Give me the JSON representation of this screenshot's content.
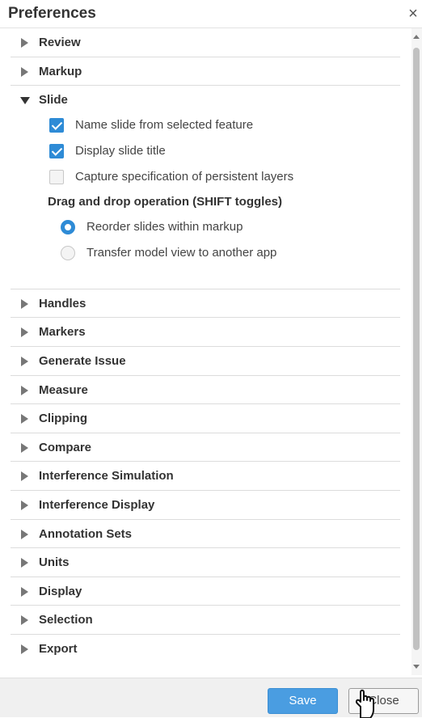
{
  "dialog": {
    "title": "Preferences",
    "close_glyph": "×"
  },
  "sections_top": [
    {
      "label": "Review",
      "expanded": false
    },
    {
      "label": "Markup",
      "expanded": false
    }
  ],
  "slide_section": {
    "label": "Slide",
    "expanded": true,
    "options": [
      {
        "label": "Name slide from selected feature",
        "checked": true
      },
      {
        "label": "Display slide title",
        "checked": true
      },
      {
        "label": "Capture specification of persistent layers",
        "checked": false
      }
    ],
    "drag_drop": {
      "title": "Drag and drop operation (SHIFT toggles)",
      "choices": [
        {
          "label": "Reorder slides within markup",
          "selected": true
        },
        {
          "label": "Transfer model view to another app",
          "selected": false
        }
      ]
    }
  },
  "sections_bottom": [
    {
      "label": "Handles"
    },
    {
      "label": "Markers"
    },
    {
      "label": "Generate Issue"
    },
    {
      "label": "Measure"
    },
    {
      "label": "Clipping"
    },
    {
      "label": "Compare"
    },
    {
      "label": "Interference Simulation"
    },
    {
      "label": "Interference Display"
    },
    {
      "label": "Annotation Sets"
    },
    {
      "label": "Units"
    },
    {
      "label": "Display"
    },
    {
      "label": "Selection"
    },
    {
      "label": "Export"
    }
  ],
  "footer": {
    "save_label": "Save",
    "close_label": "Close"
  },
  "colors": {
    "accent": "#2e8bd6",
    "save_button": "#4a9de1"
  },
  "icons": {
    "collapsed": "triangle-right-icon",
    "expanded": "triangle-down-icon",
    "cursor": "hand-pointer-icon"
  }
}
